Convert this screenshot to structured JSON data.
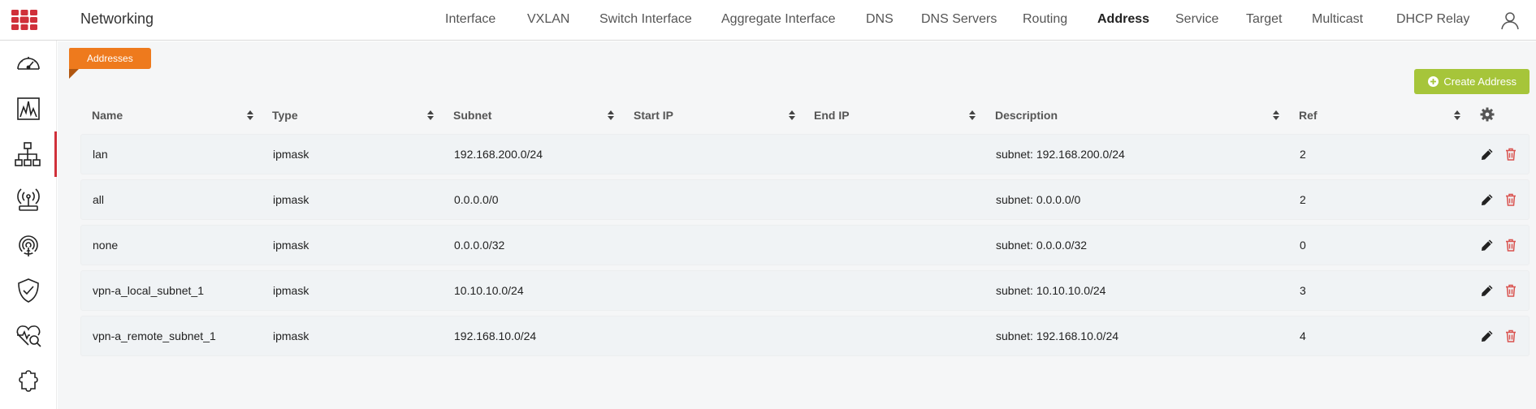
{
  "app": {
    "title": "Networking"
  },
  "nav": {
    "items": [
      {
        "label": "Interface",
        "active": false
      },
      {
        "label": "VXLAN",
        "active": false
      },
      {
        "label": "Switch Interface",
        "active": false
      },
      {
        "label": "Aggregate Interface",
        "active": false
      },
      {
        "label": "DNS",
        "active": false
      },
      {
        "label": "DNS Servers",
        "active": false
      },
      {
        "label": "Routing",
        "active": false
      },
      {
        "label": "Address",
        "active": true
      },
      {
        "label": "Service",
        "active": false
      },
      {
        "label": "Target",
        "active": false
      },
      {
        "label": "Multicast",
        "active": false
      },
      {
        "label": "DHCP Relay",
        "active": false
      }
    ]
  },
  "sidebar": {
    "items": [
      {
        "icon": "dashboard-gauge-icon",
        "active": false
      },
      {
        "icon": "monitor-chart-icon",
        "active": false
      },
      {
        "icon": "network-topology-icon",
        "active": true
      },
      {
        "icon": "wifi-access-point-icon",
        "active": false
      },
      {
        "icon": "broadcast-signal-icon",
        "active": false
      },
      {
        "icon": "security-shield-icon",
        "active": false
      },
      {
        "icon": "health-monitor-icon",
        "active": false
      },
      {
        "icon": "integration-puzzle-icon",
        "active": false
      }
    ]
  },
  "section": {
    "tag_label": "Addresses",
    "create_button_label": "Create Address"
  },
  "table": {
    "columns": [
      "Name",
      "Type",
      "Subnet",
      "Start IP",
      "End IP",
      "Description",
      "Ref"
    ],
    "rows": [
      {
        "name": "lan",
        "type": "ipmask",
        "subnet": "192.168.200.0/24",
        "start_ip": "",
        "end_ip": "",
        "description": "subnet: 192.168.200.0/24",
        "ref": "2"
      },
      {
        "name": "all",
        "type": "ipmask",
        "subnet": "0.0.0.0/0",
        "start_ip": "",
        "end_ip": "",
        "description": "subnet: 0.0.0.0/0",
        "ref": "2"
      },
      {
        "name": "none",
        "type": "ipmask",
        "subnet": "0.0.0.0/32",
        "start_ip": "",
        "end_ip": "",
        "description": "subnet: 0.0.0.0/32",
        "ref": "0"
      },
      {
        "name": "vpn-a_local_subnet_1",
        "type": "ipmask",
        "subnet": "10.10.10.0/24",
        "start_ip": "",
        "end_ip": "",
        "description": "subnet: 10.10.10.0/24",
        "ref": "3"
      },
      {
        "name": "vpn-a_remote_subnet_1",
        "type": "ipmask",
        "subnet": "192.168.10.0/24",
        "start_ip": "",
        "end_ip": "",
        "description": "subnet: 192.168.10.0/24",
        "ref": "4"
      }
    ]
  },
  "colors": {
    "accent_orange": "#ee7a1d",
    "create_green": "#a6c53a",
    "brand_red": "#d0303a",
    "delete_red": "#d9534f"
  }
}
